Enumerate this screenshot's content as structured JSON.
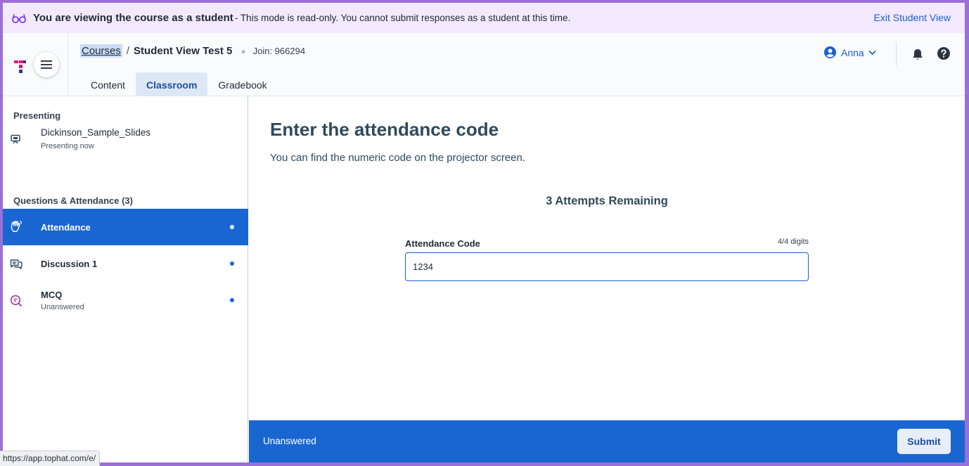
{
  "banner": {
    "title": "You are viewing the course as a student",
    "message": "- This mode is read-only. You cannot submit responses as a student at this time.",
    "exit_label": "Exit Student View"
  },
  "header": {
    "breadcrumb": {
      "courses_label": "Courses",
      "separator": "/",
      "course_name": "Student View Test 5",
      "join_label": "Join: 966294"
    },
    "tabs": [
      {
        "label": "Content",
        "active": false
      },
      {
        "label": "Classroom",
        "active": true
      },
      {
        "label": "Gradebook",
        "active": false
      }
    ],
    "user_name": "Anna"
  },
  "sidebar": {
    "presenting_title": "Presenting",
    "presenting_item": {
      "title": "Dickinson_Sample_Slides",
      "subtitle": "Presenting now"
    },
    "questions_title": "Questions & Attendance (3)",
    "items": [
      {
        "label": "Attendance",
        "subtitle": "",
        "icon": "wave-hand-icon",
        "active": true
      },
      {
        "label": "Discussion 1",
        "subtitle": "",
        "icon": "discussion-icon",
        "active": false
      },
      {
        "label": "MCQ",
        "subtitle": "Unanswered",
        "icon": "question-icon",
        "active": false
      }
    ]
  },
  "main": {
    "heading": "Enter the attendance code",
    "instruction": "You can find the numeric code on the projector screen.",
    "attempts": "3 Attempts Remaining",
    "field_label": "Attendance Code",
    "digit_count": "4/4 digits",
    "code_value": "1234"
  },
  "footer": {
    "status": "Unanswered",
    "submit_label": "Submit"
  },
  "status_bar": {
    "url": "https://app.tophat.com/e/"
  },
  "colors": {
    "accent": "#1a66d1",
    "banner_bg": "#f3e9fc",
    "frame": "#9b6fd6"
  }
}
